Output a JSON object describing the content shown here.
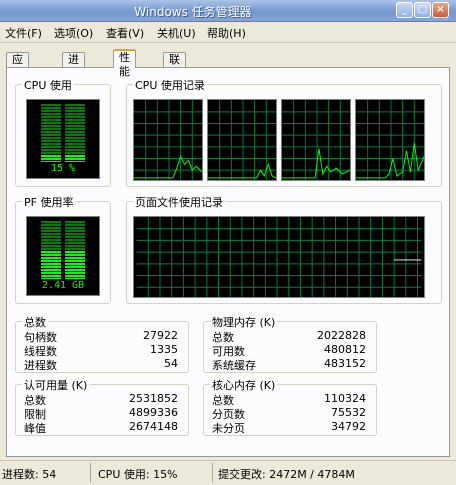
{
  "window": {
    "title": "Windows 任务管理器",
    "minimize_glyph": "_",
    "maximize_glyph": "□",
    "close_glyph": "×"
  },
  "menu": [
    "文件(F)",
    "选项(O)",
    "查看(V)",
    "关机(U)",
    "帮助(H)"
  ],
  "tabs": [
    "应用程序",
    "进程",
    "性能",
    "联网"
  ],
  "active_tab": 2,
  "cpu_usage": {
    "label": "CPU 使用",
    "value_text": "15 %",
    "fraction": 0.15
  },
  "cpu_history": {
    "label": "CPU 使用记录",
    "cores": 4
  },
  "pf_usage": {
    "label": "PF 使用率",
    "value_text": "2.41 GB",
    "fraction": 0.5
  },
  "pf_history": {
    "label": "页面文件使用记录"
  },
  "totals": {
    "label": "总数",
    "rows": [
      {
        "k": "句柄数",
        "v": "27922"
      },
      {
        "k": "线程数",
        "v": "1335"
      },
      {
        "k": "进程数",
        "v": "54"
      }
    ]
  },
  "physical_memory": {
    "label": "物理内存 (K)",
    "rows": [
      {
        "k": "总数",
        "v": "2022828"
      },
      {
        "k": "可用数",
        "v": "480812"
      },
      {
        "k": "系统缓存",
        "v": "483152"
      }
    ]
  },
  "commit_charge": {
    "label": "认可用量 (K)",
    "rows": [
      {
        "k": "总数",
        "v": "2531852"
      },
      {
        "k": "限制",
        "v": "4899336"
      },
      {
        "k": "峰值",
        "v": "2674148"
      }
    ]
  },
  "kernel_memory": {
    "label": "核心内存 (K)",
    "rows": [
      {
        "k": "总数",
        "v": "110324"
      },
      {
        "k": "分页数",
        "v": "75532"
      },
      {
        "k": "未分页",
        "v": "34792"
      }
    ]
  },
  "status": {
    "processes": "进程数: 54",
    "cpu": "CPU 使用: 15%",
    "commit": "提交更改: 2472M / 4784M"
  },
  "colors": {
    "grid": "#008040",
    "trace": "#00ff00",
    "meter_on": "#00ff00",
    "meter_off": "#008000"
  }
}
